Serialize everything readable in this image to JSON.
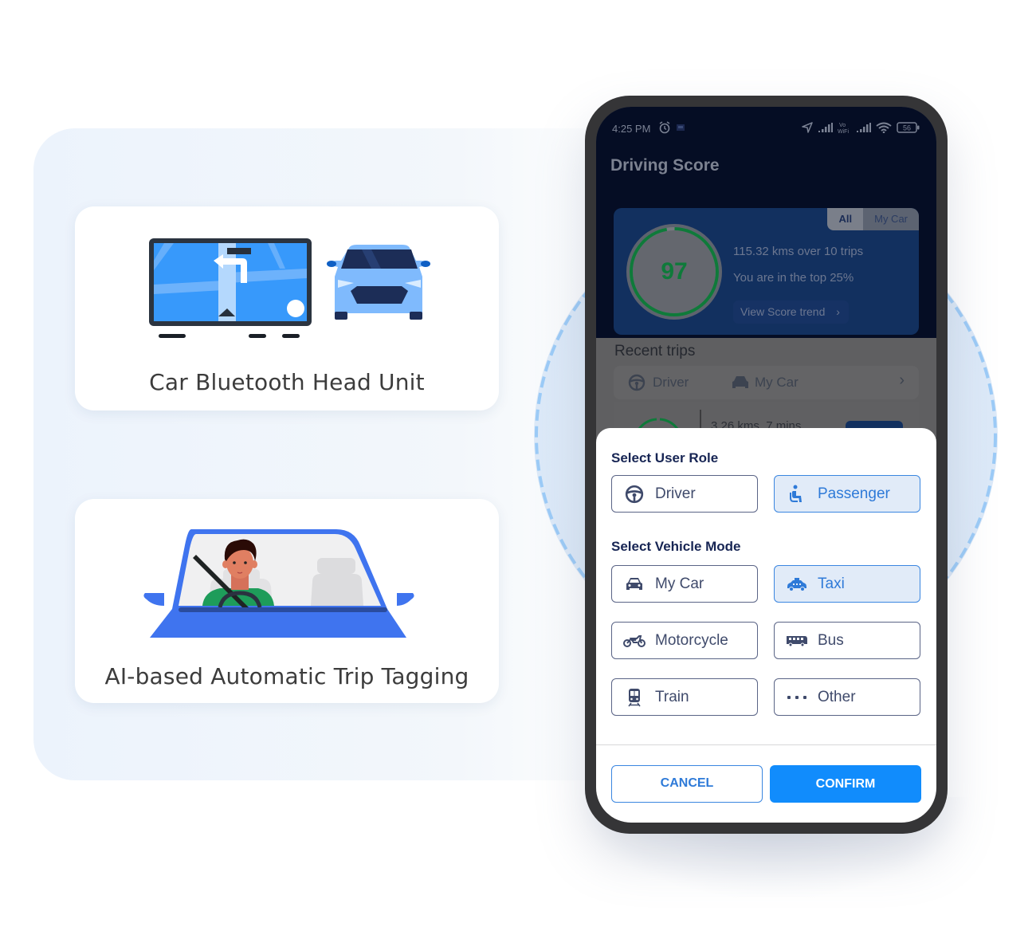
{
  "features": [
    {
      "title": "Car Bluetooth Head Unit",
      "illustration": "car-head-unit-navigation-illustration"
    },
    {
      "title": "AI-based Automatic Trip Tagging",
      "illustration": "driver-in-car-illustration"
    }
  ],
  "phone": {
    "status_bar": {
      "time": "4:25 PM",
      "left_icons": [
        "alarm-icon",
        "notification-icon"
      ],
      "right_icons": [
        "location-icon",
        "signal-icon",
        "vowifi-icon",
        "signal-icon",
        "wifi-icon"
      ],
      "vowifi_label": "Vo WiFi",
      "battery": "56"
    },
    "app_title": "Driving Score",
    "score_card": {
      "segments": [
        {
          "label": "All",
          "active": true
        },
        {
          "label": "My Car",
          "active": false
        }
      ],
      "score": "97",
      "score_fraction": 0.97,
      "distance_text": "115.32 kms over 10 trips",
      "rank_text": "You are in the top 25%",
      "trend_button": "View Score trend",
      "trend_chevron": "›"
    },
    "recent_trips": {
      "title": "Recent trips",
      "role": "Driver",
      "vehicle": "My Car",
      "chevron": "›",
      "partial_trip": "3.26 kms, 7 mins"
    },
    "sheet": {
      "role_label": "Select User Role",
      "roles": [
        {
          "label": "Driver",
          "icon": "steering-wheel-icon",
          "selected": false
        },
        {
          "label": "Passenger",
          "icon": "passenger-seat-icon",
          "selected": true
        }
      ],
      "mode_label": "Select Vehicle Mode",
      "modes": [
        {
          "label": "My Car",
          "icon": "car-icon",
          "selected": false
        },
        {
          "label": "Taxi",
          "icon": "taxi-icon",
          "selected": true
        },
        {
          "label": "Motorcycle",
          "icon": "motorcycle-icon",
          "selected": false
        },
        {
          "label": "Bus",
          "icon": "bus-icon",
          "selected": false
        },
        {
          "label": "Train",
          "icon": "train-icon",
          "selected": false
        },
        {
          "label": "Other",
          "icon": "more-dots-icon",
          "selected": false
        }
      ],
      "cancel": "CANCEL",
      "confirm": "CONFIRM"
    }
  },
  "colors": {
    "accent": "#118cfc",
    "selected_bg": "#e1ebf8",
    "header_bg": "#050d24",
    "score_green": "#0f7a3a",
    "illustration_blue": "#3f74ef"
  }
}
